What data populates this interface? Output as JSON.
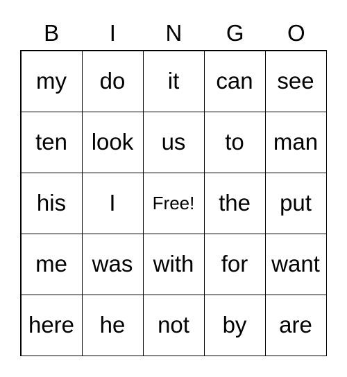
{
  "header": [
    "B",
    "I",
    "N",
    "G",
    "O"
  ],
  "cells": [
    [
      "my",
      "do",
      "it",
      "can",
      "see"
    ],
    [
      "ten",
      "look",
      "us",
      "to",
      "man"
    ],
    [
      "his",
      "I",
      "Free!",
      "the",
      "put"
    ],
    [
      "me",
      "was",
      "with",
      "for",
      "want"
    ],
    [
      "here",
      "he",
      "not",
      "by",
      "are"
    ]
  ]
}
